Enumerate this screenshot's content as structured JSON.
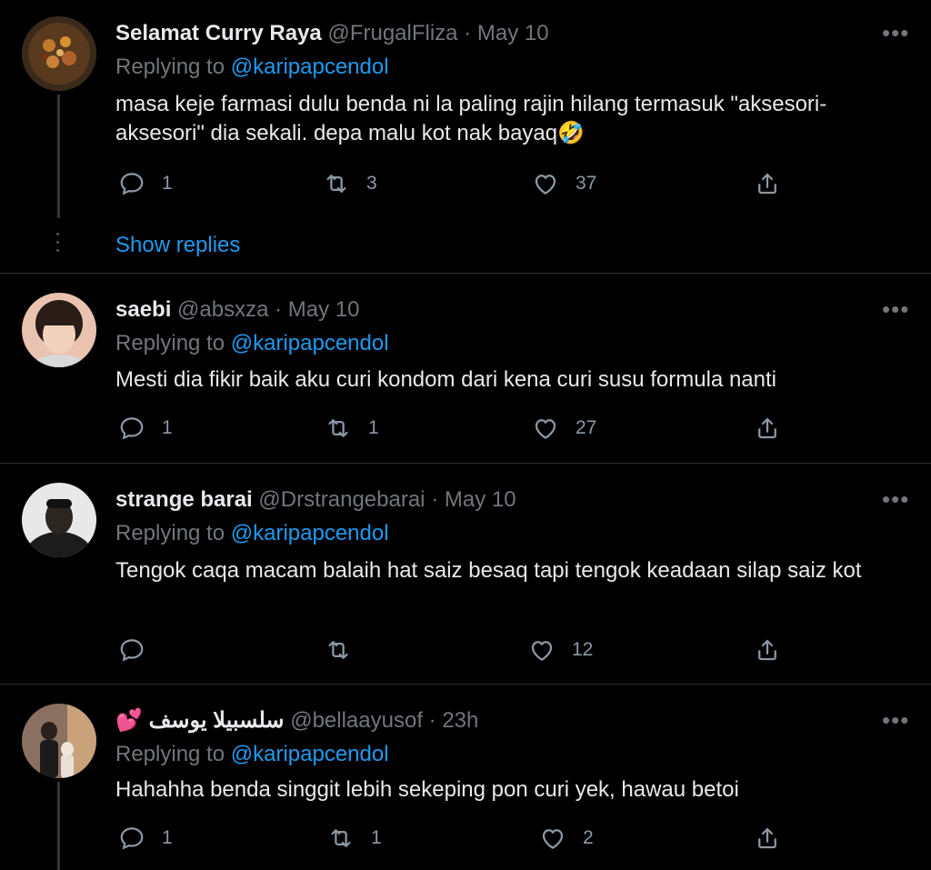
{
  "tweets": [
    {
      "name": "Selamat Curry Raya",
      "handle": "@FrugalFliza",
      "dot_date": "· May 10",
      "replying": "Replying to",
      "mention": "@karipapcendol",
      "text": "masa keje farmasi dulu benda ni la paling rajin hilang termasuk \"aksesori-aksesori\" dia sekali. depa malu kot nak bayaq🤣",
      "replies": "1",
      "retweets": "3",
      "likes": "37",
      "show_replies": "Show replies"
    },
    {
      "name": "saebi",
      "handle": "@absxza",
      "dot_date": "· May 10",
      "replying": "Replying to",
      "mention": "@karipapcendol",
      "text": "Mesti dia fikir baik aku curi kondom dari kena curi susu formula nanti",
      "replies": "1",
      "retweets": "1",
      "likes": "27"
    },
    {
      "name": "strange barai",
      "handle": "@Drstrangebarai",
      "dot_date": "· May 10",
      "replying": "Replying to",
      "mention": "@karipapcendol",
      "text": "Tengok caqa macam balaih hat saiz besaq tapi tengok keadaan silap saiz kot",
      "replies": "",
      "retweets": "",
      "likes": "12"
    },
    {
      "name": "💕 سلسبيلا يوسف",
      "handle": "@bellaayusof",
      "dot_date": "· 23h",
      "replying": "Replying to",
      "mention": "@karipapcendol",
      "text": "Hahahha benda singgit lebih sekeping pon curi yek, hawau betoi",
      "replies": "1",
      "retweets": "1",
      "likes": "2"
    }
  ],
  "icons": {
    "reply": "reply-icon",
    "retweet": "retweet-icon",
    "like": "heart-icon",
    "share": "share-icon",
    "more": "more-icon"
  },
  "colors": {
    "background": "#000000",
    "text": "#e7e9ea",
    "muted": "#71767b",
    "accent": "#1d9bf0",
    "divider": "#2f3336"
  }
}
